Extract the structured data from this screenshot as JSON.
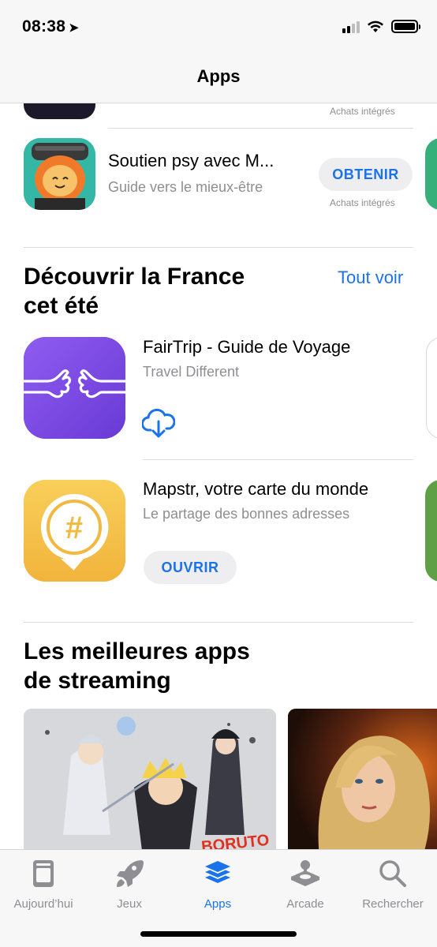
{
  "status": {
    "time": "08:38"
  },
  "nav": {
    "title": "Apps"
  },
  "top_list": {
    "prev_iap": "Achats intégrés",
    "item": {
      "name": "Soutien psy avec M...",
      "subtitle": "Guide vers le mieux-être",
      "button": "OBTENIR",
      "iap": "Achats intégrés"
    }
  },
  "section1": {
    "title_line1": "Découvrir la France",
    "title_line2": "cet été",
    "see_all": "Tout voir",
    "apps": [
      {
        "name": "FairTrip - Guide de Voyage",
        "subtitle": "Travel Different",
        "action": "download-cloud-icon",
        "icon_color": "#7d4ee6"
      },
      {
        "name": "Mapstr, votre carte du monde",
        "subtitle": "Le partage des bonnes adresses",
        "button": "OUVRIR",
        "icon_color": "#f6c44c"
      }
    ]
  },
  "section2": {
    "title_line1": "Les meilleures apps",
    "title_line2": "de streaming"
  },
  "tabs": [
    {
      "label": "Aujourd’hui",
      "icon": "today-icon",
      "active": false
    },
    {
      "label": "Jeux",
      "icon": "rocket-icon",
      "active": false
    },
    {
      "label": "Apps",
      "icon": "apps-stack-icon",
      "active": true
    },
    {
      "label": "Arcade",
      "icon": "joystick-icon",
      "active": false
    },
    {
      "label": "Rechercher",
      "icon": "search-icon",
      "active": false
    }
  ],
  "colors": {
    "accent": "#1a73e8",
    "secondary_text": "#8e8e93"
  }
}
